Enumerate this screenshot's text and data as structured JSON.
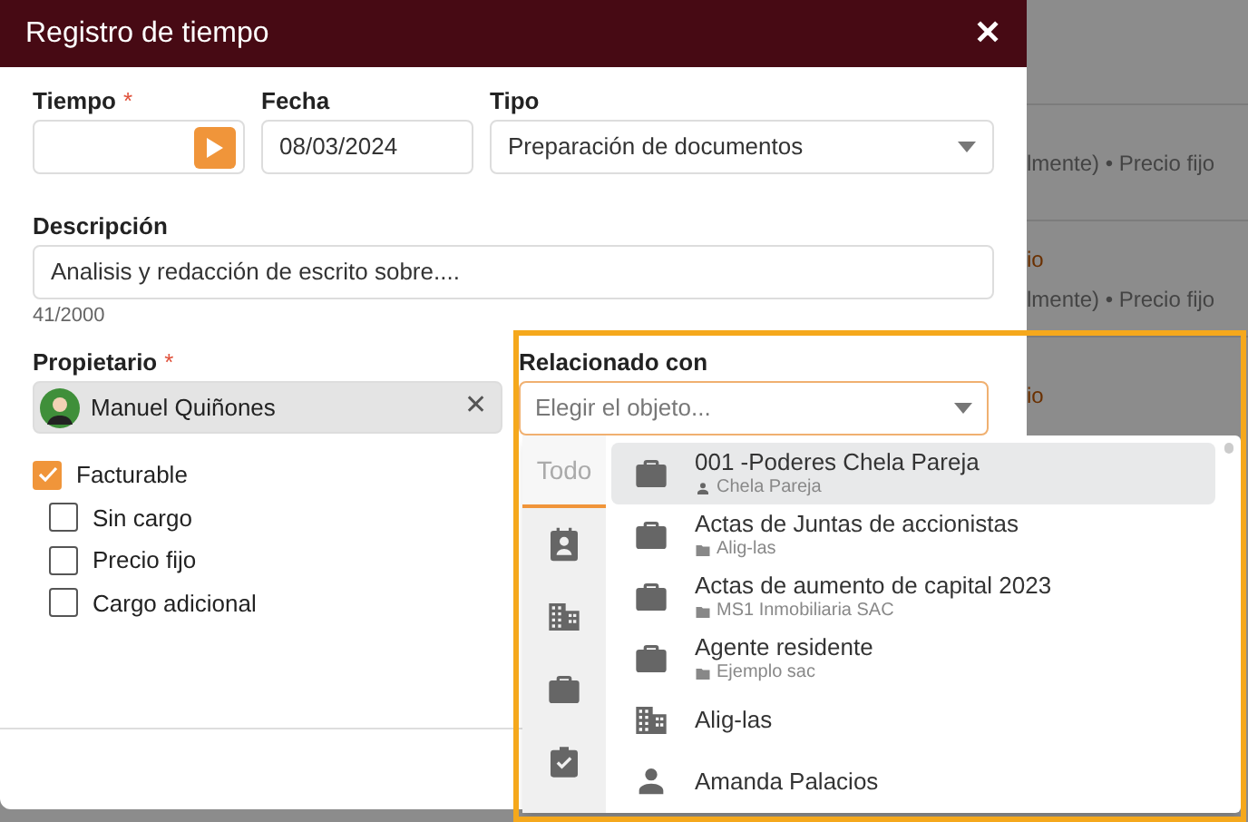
{
  "background_rows": [
    {
      "status": "",
      "detail": "lmente) • Precio fijo"
    },
    {
      "status": "io",
      "detail": "lmente) • Precio fijo"
    },
    {
      "status": "io",
      "detail": ""
    }
  ],
  "dialog": {
    "title": "Registro de tiempo",
    "close": "✕"
  },
  "fields": {
    "tiempo": {
      "label": "Tiempo",
      "required_mark": "*"
    },
    "fecha": {
      "label": "Fecha",
      "value": "08/03/2024"
    },
    "tipo": {
      "label": "Tipo",
      "value": "Preparación de documentos"
    },
    "descripcion": {
      "label": "Descripción",
      "value": "Analisis y redacción de escrito sobre....",
      "counter": "41/2000"
    },
    "propietario": {
      "label": "Propietario",
      "required_mark": "*",
      "value": "Manuel Quiñones",
      "remove": "✕"
    },
    "relacionado": {
      "label": "Relacionado con",
      "placeholder": "Elegir el objeto..."
    }
  },
  "checkboxes": [
    {
      "label": "Facturable",
      "checked": true,
      "children": [
        {
          "label": "Sin cargo",
          "checked": false
        },
        {
          "label": "Precio fijo",
          "checked": false
        },
        {
          "label": "Cargo adicional",
          "checked": false
        }
      ]
    }
  ],
  "dropdown": {
    "tabs": [
      {
        "kind": "text",
        "label": "Todo",
        "selected": true
      },
      {
        "kind": "contact",
        "selected": false
      },
      {
        "kind": "company",
        "selected": false
      },
      {
        "kind": "matter",
        "selected": false
      },
      {
        "kind": "task",
        "selected": false
      }
    ],
    "items": [
      {
        "kind": "matter",
        "title": "001 -Poderes Chela Pareja",
        "subtitle": {
          "kind": "person",
          "text": "Chela Pareja"
        },
        "selected": true
      },
      {
        "kind": "matter",
        "title": "Actas de Juntas de accionistas",
        "subtitle": {
          "kind": "folder",
          "text": "Alig-las"
        },
        "selected": false
      },
      {
        "kind": "matter",
        "title": "Actas de aumento de capital 2023",
        "subtitle": {
          "kind": "folder",
          "text": "MS1 Inmobiliaria SAC"
        },
        "selected": false
      },
      {
        "kind": "matter",
        "title": "Agente residente",
        "subtitle": {
          "kind": "folder",
          "text": "Ejemplo sac"
        },
        "selected": false
      },
      {
        "kind": "company",
        "title": "Alig-las",
        "selected": false
      },
      {
        "kind": "person",
        "title": "Amanda Palacios",
        "selected": false
      }
    ]
  }
}
